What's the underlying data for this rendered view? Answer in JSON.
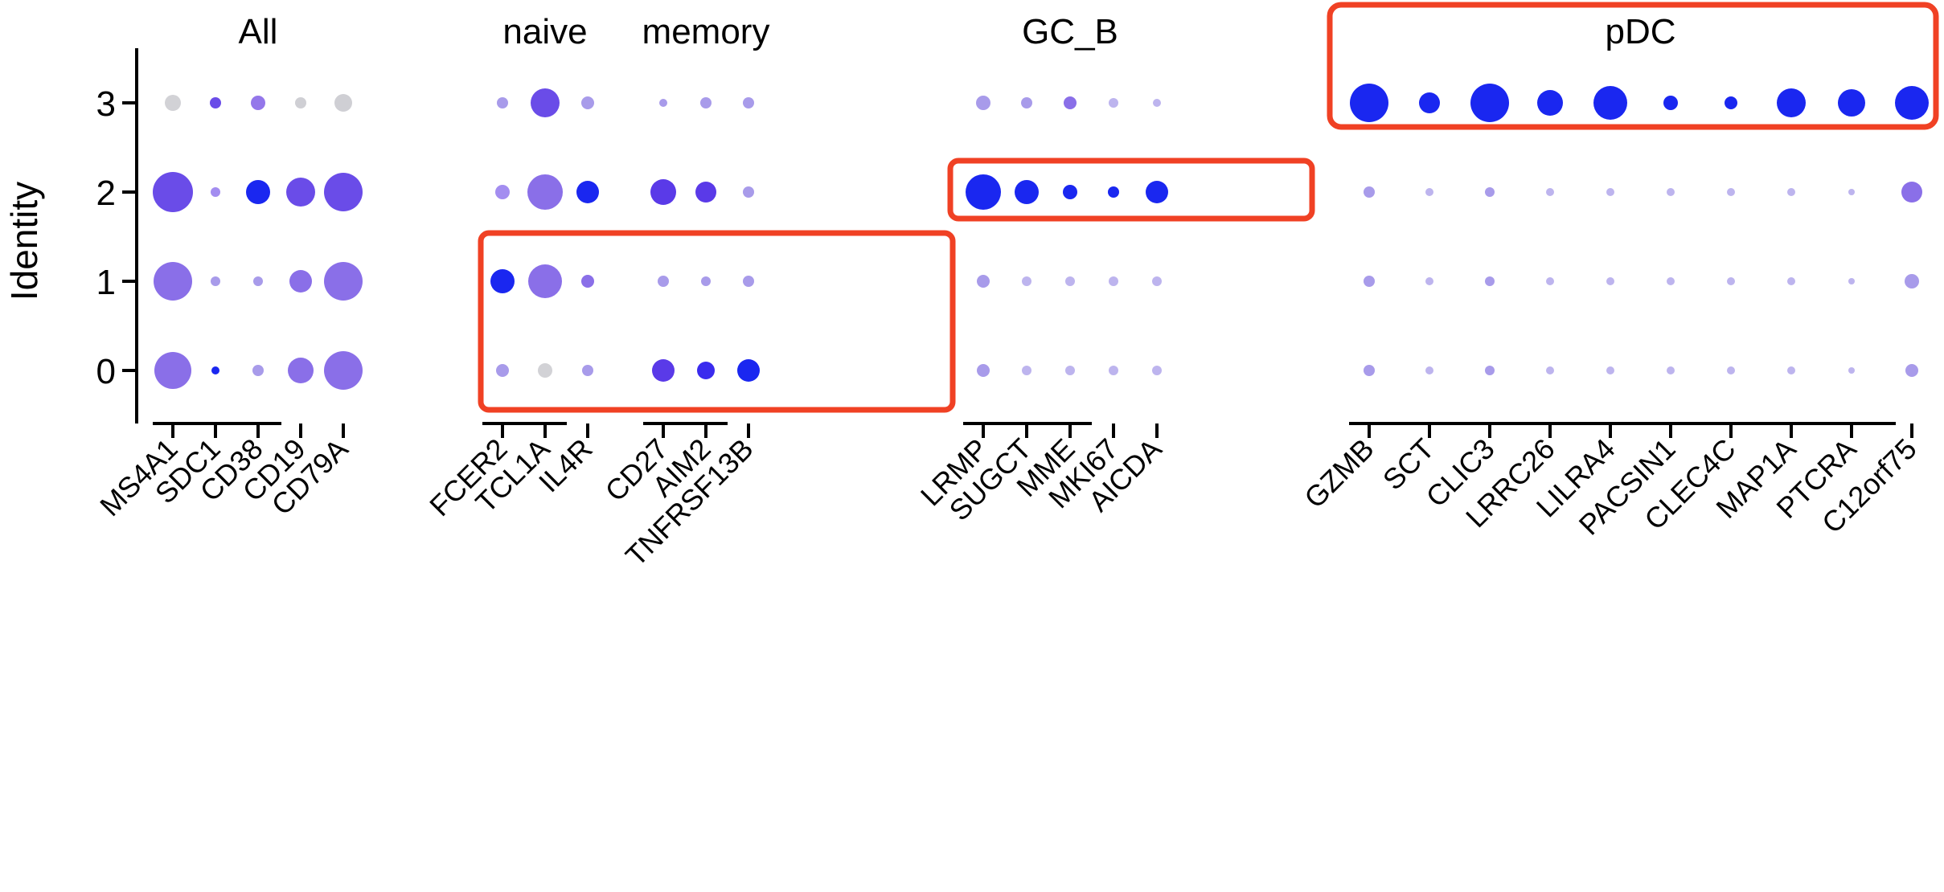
{
  "figure": {
    "type": "dotplot",
    "y_axis_title": "Identity",
    "y_ticks": [
      "0",
      "1",
      "2",
      "3"
    ],
    "y_values": [
      0,
      1,
      2,
      3
    ],
    "background": "#ffffff",
    "highlight_color": "#F04124",
    "axis_color": "#000000",
    "color_scale": {
      "low": "#d3d3d6",
      "mid": "#8a6fe8",
      "high": "#1a27f0",
      "description": "Average expression: light grey (low) through purple to blue (high)"
    },
    "size_scale": {
      "min_radius": 4,
      "max_radius": 27,
      "description": "Dot radius encodes percent of cells expressing the gene"
    }
  },
  "panels": [
    {
      "title": "All",
      "highlighted": false,
      "genes": [
        "MS4A1",
        "SDC1",
        "CD38",
        "CD19",
        "CD79A"
      ]
    },
    {
      "title": "naive",
      "highlighted": false,
      "genes": [
        "FCER2",
        "TCL1A",
        "IL4R"
      ]
    },
    {
      "title": "memory",
      "highlighted": false,
      "genes": [
        "CD27",
        "AIM2",
        "TNFRSF13B"
      ]
    },
    {
      "title": "GC_B",
      "highlighted": false,
      "genes": [
        "LRMP",
        "SUGCT",
        "MME",
        "MKI67",
        "AICDA"
      ]
    },
    {
      "title": "pDC",
      "highlighted": true,
      "genes": [
        "GZMB",
        "SCT",
        "CLIC3",
        "LRRC26",
        "LILRA4",
        "PACSIN1",
        "CLEC4C",
        "MAP1A",
        "PTCRA",
        "C12orf75"
      ]
    }
  ],
  "highlight_boxes": [
    {
      "name": "naive-memory-row0-row1-highlight",
      "panel_span": "naive+memory",
      "rows": [
        0,
        1
      ]
    },
    {
      "name": "gcb-row2-highlight",
      "panel_span": "GC_B",
      "rows": [
        2
      ]
    },
    {
      "name": "pdc-row3-highlight",
      "panel_span": "pDC",
      "rows": [
        3
      ]
    }
  ],
  "chart_data": {
    "type": "scatter",
    "title": "",
    "xlabel": "",
    "ylabel": "Identity",
    "ylim": [
      -0.6,
      3.6
    ],
    "grid": false,
    "legend": "none",
    "encoding": {
      "x": "gene",
      "y": "identity cluster",
      "size": "percent expressed",
      "color": "average expression"
    },
    "panels": [
      {
        "title": "All",
        "genes": [
          "MS4A1",
          "SDC1",
          "CD38",
          "CD19",
          "CD79A"
        ],
        "points": [
          {
            "gene": "MS4A1",
            "identity": 3,
            "radius": 10,
            "color": "#d2d2d6"
          },
          {
            "gene": "SDC1",
            "identity": 3,
            "radius": 7,
            "color": "#6a4ce8"
          },
          {
            "gene": "CD38",
            "identity": 3,
            "radius": 9,
            "color": "#9477ea"
          },
          {
            "gene": "CD19",
            "identity": 3,
            "radius": 7,
            "color": "#cfcfd4"
          },
          {
            "gene": "CD79A",
            "identity": 3,
            "radius": 11,
            "color": "#cfcfd4"
          },
          {
            "gene": "MS4A1",
            "identity": 2,
            "radius": 25,
            "color": "#6a4ce8"
          },
          {
            "gene": "SDC1",
            "identity": 2,
            "radius": 6,
            "color": "#a38df0"
          },
          {
            "gene": "CD38",
            "identity": 2,
            "radius": 15,
            "color": "#1a27f0"
          },
          {
            "gene": "CD19",
            "identity": 2,
            "radius": 18,
            "color": "#6a4ce8"
          },
          {
            "gene": "CD79A",
            "identity": 2,
            "radius": 24,
            "color": "#6a4ce8"
          },
          {
            "gene": "MS4A1",
            "identity": 1,
            "radius": 24,
            "color": "#8a6fe8"
          },
          {
            "gene": "SDC1",
            "identity": 1,
            "radius": 6,
            "color": "#a89bea"
          },
          {
            "gene": "CD38",
            "identity": 1,
            "radius": 6,
            "color": "#a89bea"
          },
          {
            "gene": "CD19",
            "identity": 1,
            "radius": 14,
            "color": "#8a6fe8"
          },
          {
            "gene": "CD79A",
            "identity": 1,
            "radius": 24,
            "color": "#8a6fe8"
          },
          {
            "gene": "MS4A1",
            "identity": 0,
            "radius": 23,
            "color": "#8a6fe8"
          },
          {
            "gene": "SDC1",
            "identity": 0,
            "radius": 5,
            "color": "#1a27f0"
          },
          {
            "gene": "CD38",
            "identity": 0,
            "radius": 7,
            "color": "#a89bea"
          },
          {
            "gene": "CD19",
            "identity": 0,
            "radius": 16,
            "color": "#8a6fe8"
          },
          {
            "gene": "CD79A",
            "identity": 0,
            "radius": 24,
            "color": "#8a6fe8"
          }
        ]
      },
      {
        "title": "naive",
        "genes": [
          "FCER2",
          "TCL1A",
          "IL4R"
        ],
        "points": [
          {
            "gene": "FCER2",
            "identity": 3,
            "radius": 7,
            "color": "#a89bea"
          },
          {
            "gene": "TCL1A",
            "identity": 3,
            "radius": 18,
            "color": "#6a4ce8"
          },
          {
            "gene": "IL4R",
            "identity": 3,
            "radius": 8,
            "color": "#a89bea"
          },
          {
            "gene": "FCER2",
            "identity": 2,
            "radius": 9,
            "color": "#a38df0"
          },
          {
            "gene": "TCL1A",
            "identity": 2,
            "radius": 22,
            "color": "#8a6fe8"
          },
          {
            "gene": "IL4R",
            "identity": 2,
            "radius": 14,
            "color": "#1a27f0"
          },
          {
            "gene": "FCER2",
            "identity": 1,
            "radius": 15,
            "color": "#1a27f0"
          },
          {
            "gene": "TCL1A",
            "identity": 1,
            "radius": 21,
            "color": "#8a6fe8"
          },
          {
            "gene": "IL4R",
            "identity": 1,
            "radius": 8,
            "color": "#8a6fe8"
          },
          {
            "gene": "FCER2",
            "identity": 0,
            "radius": 8,
            "color": "#a89bea"
          },
          {
            "gene": "TCL1A",
            "identity": 0,
            "radius": 9,
            "color": "#d2d2d6"
          },
          {
            "gene": "IL4R",
            "identity": 0,
            "radius": 7,
            "color": "#a89bea"
          }
        ]
      },
      {
        "title": "memory",
        "genes": [
          "CD27",
          "AIM2",
          "TNFRSF13B"
        ],
        "points": [
          {
            "gene": "CD27",
            "identity": 3,
            "radius": 5,
            "color": "#a89bea"
          },
          {
            "gene": "AIM2",
            "identity": 3,
            "radius": 7,
            "color": "#a89bea"
          },
          {
            "gene": "TNFRSF13B",
            "identity": 3,
            "radius": 7,
            "color": "#a89bea"
          },
          {
            "gene": "CD27",
            "identity": 2,
            "radius": 16,
            "color": "#5a3ae8"
          },
          {
            "gene": "AIM2",
            "identity": 2,
            "radius": 13,
            "color": "#5a3ae8"
          },
          {
            "gene": "TNFRSF13B",
            "identity": 2,
            "radius": 7,
            "color": "#a89bea"
          },
          {
            "gene": "CD27",
            "identity": 1,
            "radius": 7,
            "color": "#a89bea"
          },
          {
            "gene": "AIM2",
            "identity": 1,
            "radius": 6,
            "color": "#a89bea"
          },
          {
            "gene": "TNFRSF13B",
            "identity": 1,
            "radius": 7,
            "color": "#a89bea"
          },
          {
            "gene": "CD27",
            "identity": 0,
            "radius": 14,
            "color": "#5a3ae8"
          },
          {
            "gene": "AIM2",
            "identity": 0,
            "radius": 11,
            "color": "#3a2bee"
          },
          {
            "gene": "TNFRSF13B",
            "identity": 0,
            "radius": 14,
            "color": "#1a27f0"
          }
        ]
      },
      {
        "title": "GC_B",
        "genes": [
          "LRMP",
          "SUGCT",
          "MME",
          "MKI67",
          "AICDA"
        ],
        "points": [
          {
            "gene": "LRMP",
            "identity": 3,
            "radius": 9,
            "color": "#a89bea"
          },
          {
            "gene": "SUGCT",
            "identity": 3,
            "radius": 7,
            "color": "#a89bea"
          },
          {
            "gene": "MME",
            "identity": 3,
            "radius": 8,
            "color": "#8a6fe8"
          },
          {
            "gene": "MKI67",
            "identity": 3,
            "radius": 6,
            "color": "#bdb4ee"
          },
          {
            "gene": "AICDA",
            "identity": 3,
            "radius": 5,
            "color": "#bdb4ee"
          },
          {
            "gene": "LRMP",
            "identity": 2,
            "radius": 22,
            "color": "#1a27f0"
          },
          {
            "gene": "SUGCT",
            "identity": 2,
            "radius": 15,
            "color": "#1a27f0"
          },
          {
            "gene": "MME",
            "identity": 2,
            "radius": 9,
            "color": "#1a27f0"
          },
          {
            "gene": "MKI67",
            "identity": 2,
            "radius": 7,
            "color": "#1a27f0"
          },
          {
            "gene": "AICDA",
            "identity": 2,
            "radius": 14,
            "color": "#1a27f0"
          },
          {
            "gene": "LRMP",
            "identity": 1,
            "radius": 8,
            "color": "#a89bea"
          },
          {
            "gene": "SUGCT",
            "identity": 1,
            "radius": 6,
            "color": "#bdb4ee"
          },
          {
            "gene": "MME",
            "identity": 1,
            "radius": 6,
            "color": "#bdb4ee"
          },
          {
            "gene": "MKI67",
            "identity": 1,
            "radius": 6,
            "color": "#bdb4ee"
          },
          {
            "gene": "AICDA",
            "identity": 1,
            "radius": 6,
            "color": "#bdb4ee"
          },
          {
            "gene": "LRMP",
            "identity": 0,
            "radius": 8,
            "color": "#a89bea"
          },
          {
            "gene": "SUGCT",
            "identity": 0,
            "radius": 6,
            "color": "#bdb4ee"
          },
          {
            "gene": "MME",
            "identity": 0,
            "radius": 6,
            "color": "#bdb4ee"
          },
          {
            "gene": "MKI67",
            "identity": 0,
            "radius": 6,
            "color": "#bdb4ee"
          },
          {
            "gene": "AICDA",
            "identity": 0,
            "radius": 6,
            "color": "#bdb4ee"
          }
        ]
      },
      {
        "title": "pDC",
        "genes": [
          "GZMB",
          "SCT",
          "CLIC3",
          "LRRC26",
          "LILRA4",
          "PACSIN1",
          "CLEC4C",
          "MAP1A",
          "PTCRA",
          "C12orf75"
        ],
        "points": [
          {
            "gene": "GZMB",
            "identity": 3,
            "radius": 24,
            "color": "#1a27f0"
          },
          {
            "gene": "SCT",
            "identity": 3,
            "radius": 13,
            "color": "#1a27f0"
          },
          {
            "gene": "CLIC3",
            "identity": 3,
            "radius": 24,
            "color": "#1a27f0"
          },
          {
            "gene": "LRRC26",
            "identity": 3,
            "radius": 16,
            "color": "#1a27f0"
          },
          {
            "gene": "LILRA4",
            "identity": 3,
            "radius": 21,
            "color": "#1a27f0"
          },
          {
            "gene": "PACSIN1",
            "identity": 3,
            "radius": 9,
            "color": "#1a27f0"
          },
          {
            "gene": "CLEC4C",
            "identity": 3,
            "radius": 8,
            "color": "#1a27f0"
          },
          {
            "gene": "MAP1A",
            "identity": 3,
            "radius": 18,
            "color": "#1a27f0"
          },
          {
            "gene": "PTCRA",
            "identity": 3,
            "radius": 17,
            "color": "#1a27f0"
          },
          {
            "gene": "C12orf75",
            "identity": 3,
            "radius": 21,
            "color": "#1a27f0"
          },
          {
            "gene": "GZMB",
            "identity": 2,
            "radius": 7,
            "color": "#a89bea"
          },
          {
            "gene": "SCT",
            "identity": 2,
            "radius": 5,
            "color": "#bdb4ee"
          },
          {
            "gene": "CLIC3",
            "identity": 2,
            "radius": 6,
            "color": "#a89bea"
          },
          {
            "gene": "LRRC26",
            "identity": 2,
            "radius": 5,
            "color": "#bdb4ee"
          },
          {
            "gene": "LILRA4",
            "identity": 2,
            "radius": 5,
            "color": "#bdb4ee"
          },
          {
            "gene": "PACSIN1",
            "identity": 2,
            "radius": 5,
            "color": "#bdb4ee"
          },
          {
            "gene": "CLEC4C",
            "identity": 2,
            "radius": 5,
            "color": "#bdb4ee"
          },
          {
            "gene": "MAP1A",
            "identity": 2,
            "radius": 5,
            "color": "#bdb4ee"
          },
          {
            "gene": "PTCRA",
            "identity": 2,
            "radius": 4,
            "color": "#bdb4ee"
          },
          {
            "gene": "C12orf75",
            "identity": 2,
            "radius": 13,
            "color": "#8a6fe8"
          },
          {
            "gene": "GZMB",
            "identity": 1,
            "radius": 7,
            "color": "#a89bea"
          },
          {
            "gene": "SCT",
            "identity": 1,
            "radius": 5,
            "color": "#bdb4ee"
          },
          {
            "gene": "CLIC3",
            "identity": 1,
            "radius": 6,
            "color": "#a89bea"
          },
          {
            "gene": "LRRC26",
            "identity": 1,
            "radius": 5,
            "color": "#bdb4ee"
          },
          {
            "gene": "LILRA4",
            "identity": 1,
            "radius": 5,
            "color": "#bdb4ee"
          },
          {
            "gene": "PACSIN1",
            "identity": 1,
            "radius": 5,
            "color": "#bdb4ee"
          },
          {
            "gene": "CLEC4C",
            "identity": 1,
            "radius": 5,
            "color": "#bdb4ee"
          },
          {
            "gene": "MAP1A",
            "identity": 1,
            "radius": 5,
            "color": "#bdb4ee"
          },
          {
            "gene": "PTCRA",
            "identity": 1,
            "radius": 4,
            "color": "#bdb4ee"
          },
          {
            "gene": "C12orf75",
            "identity": 1,
            "radius": 9,
            "color": "#a89bea"
          },
          {
            "gene": "GZMB",
            "identity": 0,
            "radius": 7,
            "color": "#a89bea"
          },
          {
            "gene": "SCT",
            "identity": 0,
            "radius": 5,
            "color": "#bdb4ee"
          },
          {
            "gene": "CLIC3",
            "identity": 0,
            "radius": 6,
            "color": "#a89bea"
          },
          {
            "gene": "LRRC26",
            "identity": 0,
            "radius": 5,
            "color": "#bdb4ee"
          },
          {
            "gene": "LILRA4",
            "identity": 0,
            "radius": 5,
            "color": "#bdb4ee"
          },
          {
            "gene": "PACSIN1",
            "identity": 0,
            "radius": 5,
            "color": "#bdb4ee"
          },
          {
            "gene": "CLEC4C",
            "identity": 0,
            "radius": 5,
            "color": "#bdb4ee"
          },
          {
            "gene": "MAP1A",
            "identity": 0,
            "radius": 5,
            "color": "#bdb4ee"
          },
          {
            "gene": "PTCRA",
            "identity": 0,
            "radius": 4,
            "color": "#bdb4ee"
          },
          {
            "gene": "C12orf75",
            "identity": 0,
            "radius": 8,
            "color": "#a89bea"
          }
        ]
      }
    ]
  }
}
